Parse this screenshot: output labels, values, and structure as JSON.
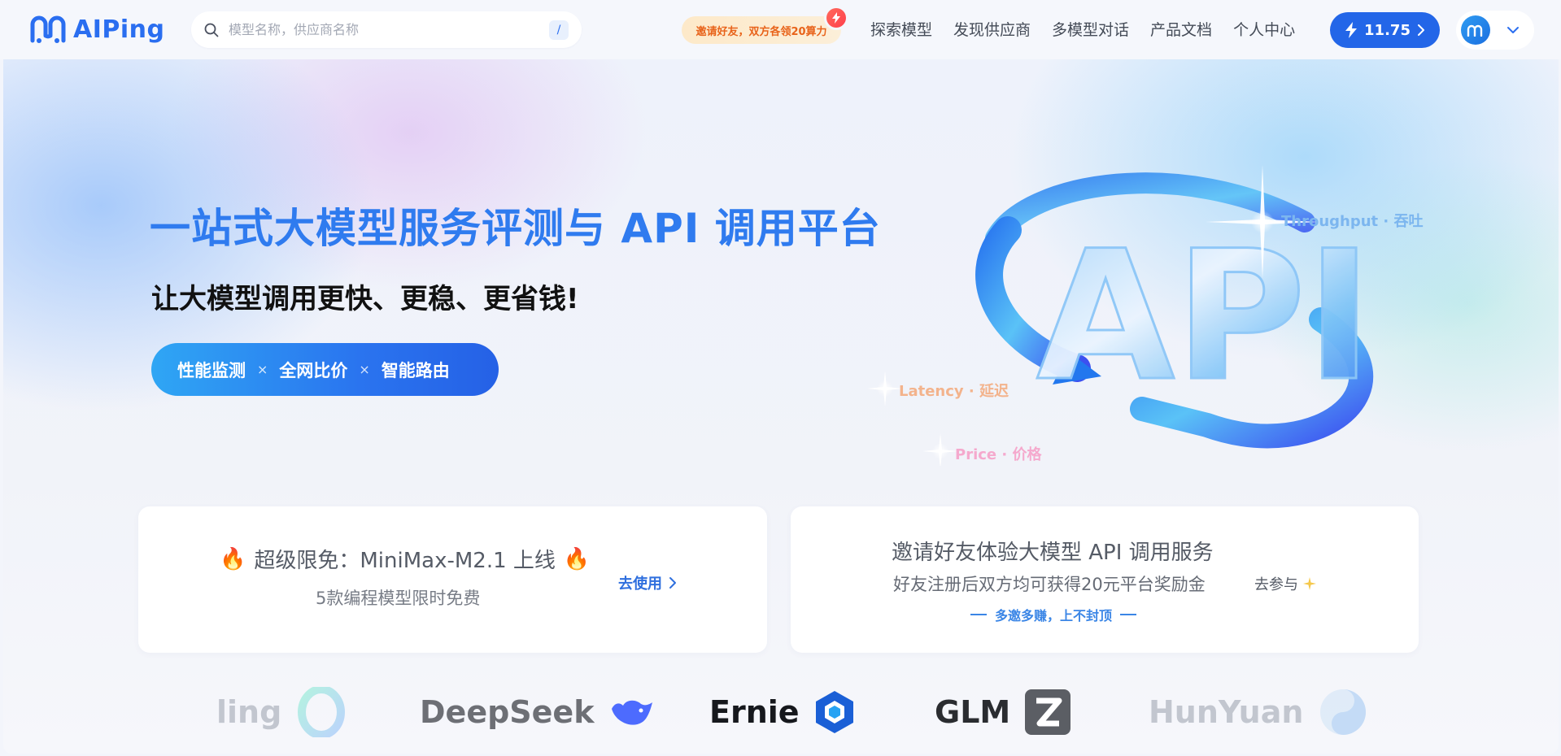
{
  "app": {
    "logo_text": "AIPing"
  },
  "search": {
    "placeholder": "模型名称，供应商名称",
    "shortcut": "/"
  },
  "promo": {
    "invite_label": "邀请好友，双方各领20算力"
  },
  "nav": {
    "items": [
      {
        "label": "探索模型"
      },
      {
        "label": "发现供应商"
      },
      {
        "label": "多模型对话"
      },
      {
        "label": "产品文档"
      },
      {
        "label": "个人中心"
      }
    ]
  },
  "account": {
    "balance": "11.75",
    "avatar_letter": "m"
  },
  "hero": {
    "title": "一站式大模型服务评测与 API 调用平台",
    "subtitle": "让大模型调用更快、更稳、更省钱!",
    "features": [
      "性能监测",
      "全网比价",
      "智能路由"
    ],
    "separator": "×"
  },
  "graphic": {
    "main_text": "API",
    "tags": [
      {
        "text": "Throughput · 吞吐",
        "color": "#7cb6ef"
      },
      {
        "text": "Latency · 延迟",
        "color": "#f3b38c"
      },
      {
        "text": "Price · 价格",
        "color": "#f5a9cd"
      }
    ]
  },
  "cards": {
    "free": {
      "title": "超级限免：MiniMax-M2.1 上线",
      "subtitle": "5款编程模型限时免费",
      "link": "去使用"
    },
    "invite": {
      "title": "邀请好友体验大模型 API 调用服务",
      "subtitle": "好友注册后双方均可获得20元平台奖励金",
      "slogan": "多邀多赚，上不封顶",
      "link": "去参与"
    }
  },
  "brands": [
    {
      "name": "ling",
      "color": "#c2c6cf"
    },
    {
      "name": "DeepSeek",
      "color": "#6d6f75"
    },
    {
      "name": "Ernie",
      "color": "#16181d"
    },
    {
      "name": "GLM",
      "color": "#2a2c30"
    },
    {
      "name": "HunYuan",
      "color": "#c2c6cf"
    }
  ],
  "colors": {
    "brand_blue": "#2a6ef0",
    "button_blue": "#2366e8",
    "promo_orange": "#e8631a"
  }
}
